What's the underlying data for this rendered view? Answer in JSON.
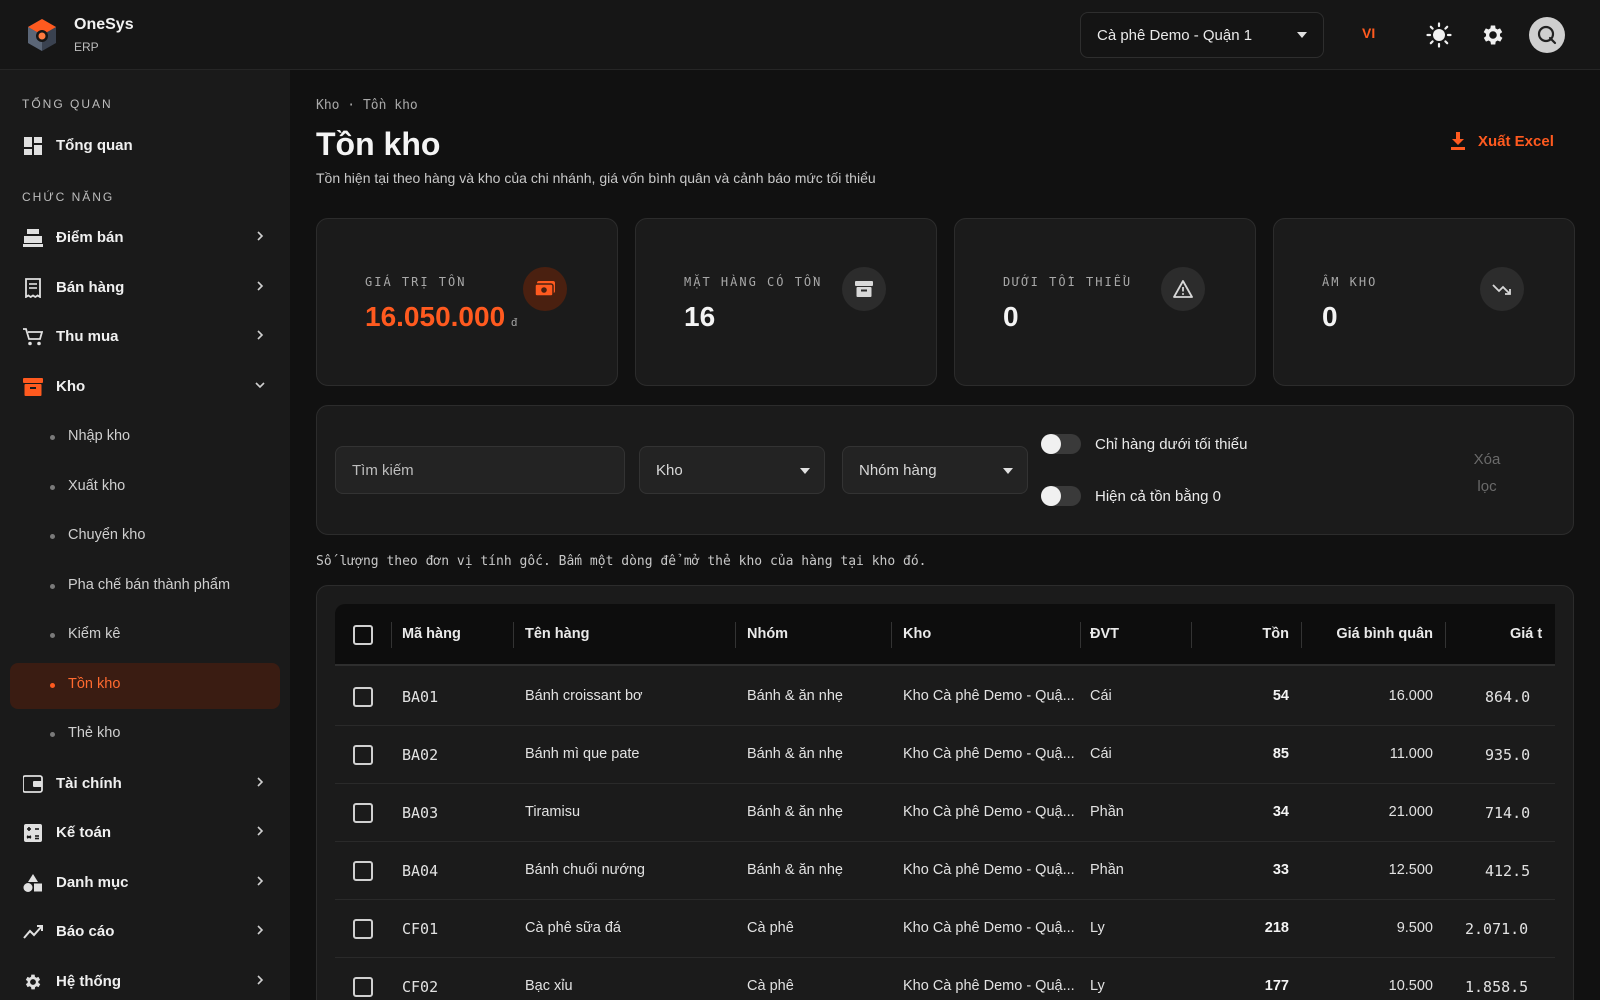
{
  "brand": {
    "name": "OneSys",
    "sub": "ERP"
  },
  "topbar": {
    "branch": "Cà phê Demo - Quận 1",
    "lang": "VI"
  },
  "sidebar": {
    "section_overview": "TỔNG QUAN",
    "section_functions": "CHỨC NĂNG",
    "items": {
      "overview": "Tổng quan",
      "pos": "Điểm bán",
      "sales": "Bán hàng",
      "purchase": "Thu mua",
      "warehouse": "Kho",
      "finance": "Tài chính",
      "accounting": "Kế toán",
      "catalog": "Danh mục",
      "reports": "Báo cáo",
      "system": "Hệ thống"
    },
    "sub_items": [
      "Nhập kho",
      "Xuất kho",
      "Chuyển kho",
      "Pha chế bán thành phẩm",
      "Kiểm kê",
      "Tồn kho",
      "Thẻ kho"
    ]
  },
  "page": {
    "breadcrumb": "Kho · Tồn kho",
    "title": "Tồn kho",
    "subtitle": "Tồn hiện tại theo hàng và kho của chi nhánh, giá vốn bình quân và cảnh báo mức tối thiểu",
    "export_label": "Xuất Excel"
  },
  "stats": [
    {
      "label": "GIÁ TRỊ TỒN",
      "value": "16.050.000",
      "unit": "đ"
    },
    {
      "label": "MẶT HÀNG CÓ TỒN",
      "value": "16"
    },
    {
      "label": "DƯỚI TỐI THIỂU",
      "value": "0"
    },
    {
      "label": "ÂM KHO",
      "value": "0"
    }
  ],
  "filters": {
    "search_placeholder": "Tìm kiếm",
    "warehouse": "Kho",
    "group": "Nhóm hàng",
    "toggle_below_min": "Chỉ hàng dưới tối thiểu",
    "toggle_show_zero": "Hiện cả tồn bằng 0",
    "clear": "Xóa lọc"
  },
  "note": "Số lượng theo đơn vị tính gốc. Bấm một dòng để mở thẻ kho của hàng tại kho đó.",
  "table": {
    "headers": [
      "Mã hàng",
      "Tên hàng",
      "Nhóm",
      "Kho",
      "ĐVT",
      "Tồn",
      "Giá bình quân",
      "Giá t"
    ],
    "rows": [
      [
        "BA01",
        "Bánh croissant bơ",
        "Bánh & ăn nhẹ",
        "Kho Cà phê Demo - Quậ...",
        "Cái",
        "54",
        "16.000",
        "864.0"
      ],
      [
        "BA02",
        "Bánh mì que pate",
        "Bánh & ăn nhẹ",
        "Kho Cà phê Demo - Quậ...",
        "Cái",
        "85",
        "11.000",
        "935.0"
      ],
      [
        "BA03",
        "Tiramisu",
        "Bánh & ăn nhẹ",
        "Kho Cà phê Demo - Quậ...",
        "Phần",
        "34",
        "21.000",
        "714.0"
      ],
      [
        "BA04",
        "Bánh chuối nướng",
        "Bánh & ăn nhẹ",
        "Kho Cà phê Demo - Quậ...",
        "Phần",
        "33",
        "12.500",
        "412.5"
      ],
      [
        "CF01",
        "Cà phê sữa đá",
        "Cà phê",
        "Kho Cà phê Demo - Quậ...",
        "Ly",
        "218",
        "9.500",
        "2.071.0"
      ],
      [
        "CF02",
        "Bạc xỉu",
        "Cà phê",
        "Kho Cà phê Demo - Quậ...",
        "Ly",
        "177",
        "10.500",
        "1.858.5"
      ]
    ]
  },
  "colors": {
    "accent": "#ff5a1f",
    "bg": "#111111",
    "panel": "#1b1b1b"
  }
}
